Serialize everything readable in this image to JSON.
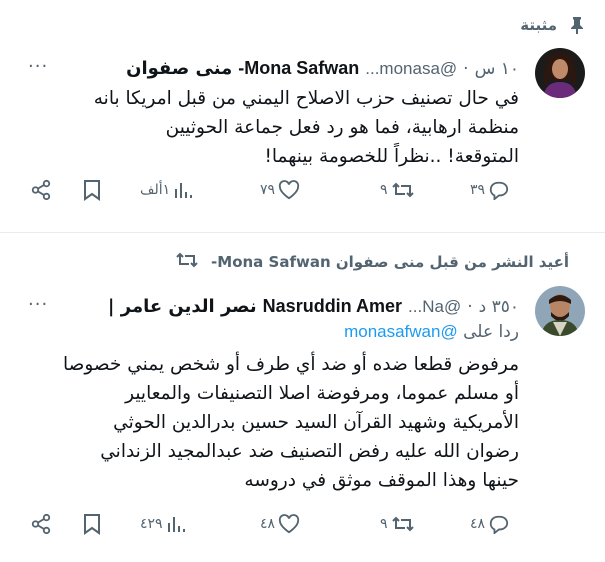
{
  "pinned": {
    "label": "مثبتة",
    "icon": "pin-icon"
  },
  "tweet1": {
    "display_name_ar": "منى صفوان",
    "display_name_en": "Mona Safwan-",
    "handle": "@monasa...",
    "separator": "·",
    "time": "١٠ س",
    "more_icon": "more-icon",
    "text": "في حال تصنيف حزب الاصلاح اليمني  من قبل امريكا بانه\nمنظمة  ارهابية، فما هو رد فعل جماعة الحوثيين\nالمتوقعة! ..نظراً للخصومة بينهما!",
    "actions": {
      "reply_count": "٣٩",
      "retweet_count": "٩",
      "like_count": "٧٩",
      "views_count": "١ألف"
    }
  },
  "retweet_banner": {
    "label": "أعيد النشر من قبل منى صفوان Mona Safwan-",
    "icon": "retweet-icon"
  },
  "tweet2": {
    "display_name_ar": "نصر الدين عامر |",
    "display_name_en": "Nasruddin Amer",
    "handle": "@Na...",
    "separator": "·",
    "time": "٣٥٠ د",
    "more_icon": "more-icon",
    "reply_prefix": "ردا على",
    "reply_handle": "@monasafwan",
    "text": "مرفوض قطعا ضده أو ضد أي طرف أو شخص يمني خصوصا\nأو مسلم عموما،  ومرفوضة اصلا التصنيفات والمعايير\nالأمريكية  وشهيد القرآن السيد حسين بدرالدين الحوثي\nرضوان الله عليه رفض التصنيف ضد عبدالمجيد الزنداني\nحينها وهذا الموقف موثق في دروسه",
    "actions": {
      "reply_count": "٤٨",
      "retweet_count": "٩",
      "like_count": "٤٨",
      "views_count": "٤٢٩"
    }
  },
  "colors": {
    "muted": "#536471",
    "text": "#0f1419",
    "link": "#1d9bf0",
    "divider": "#e6ecf0"
  }
}
